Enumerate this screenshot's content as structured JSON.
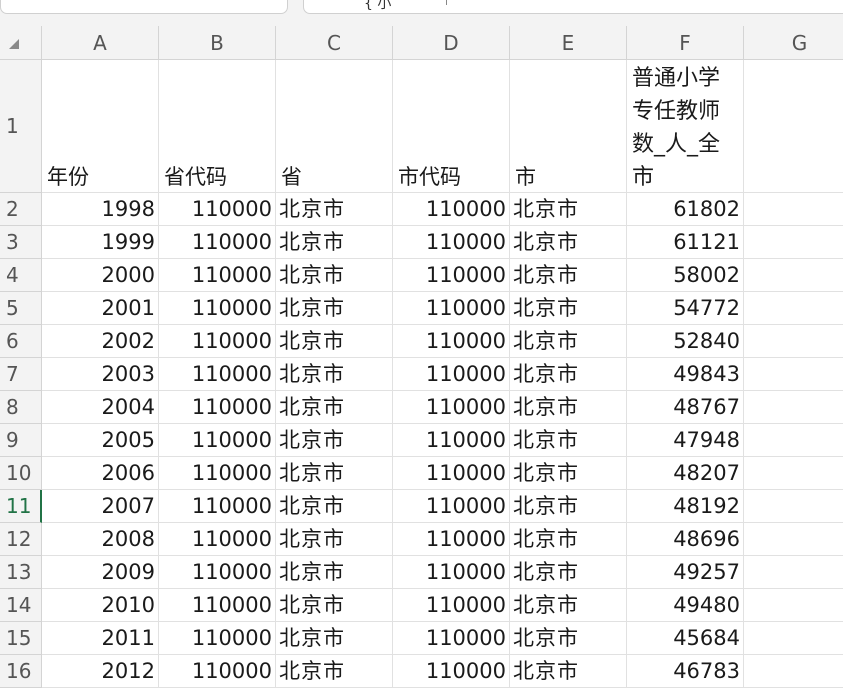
{
  "columns": [
    "A",
    "B",
    "C",
    "D",
    "E",
    "F",
    "G"
  ],
  "rowNumbers": [
    "1",
    "2",
    "3",
    "4",
    "5",
    "6",
    "7",
    "8",
    "9",
    "10",
    "11",
    "12",
    "13",
    "14",
    "15",
    "16"
  ],
  "activeRow": "11",
  "formula_glyph": "{ 小",
  "headers": [
    "年份",
    "省代码",
    "省",
    "市代码",
    "市",
    "普通小学专任教师数_人_全市"
  ],
  "rows": [
    [
      "1998",
      "110000",
      "北京市",
      "110000",
      "北京市",
      "61802"
    ],
    [
      "1999",
      "110000",
      "北京市",
      "110000",
      "北京市",
      "61121"
    ],
    [
      "2000",
      "110000",
      "北京市",
      "110000",
      "北京市",
      "58002"
    ],
    [
      "2001",
      "110000",
      "北京市",
      "110000",
      "北京市",
      "54772"
    ],
    [
      "2002",
      "110000",
      "北京市",
      "110000",
      "北京市",
      "52840"
    ],
    [
      "2003",
      "110000",
      "北京市",
      "110000",
      "北京市",
      "49843"
    ],
    [
      "2004",
      "110000",
      "北京市",
      "110000",
      "北京市",
      "48767"
    ],
    [
      "2005",
      "110000",
      "北京市",
      "110000",
      "北京市",
      "47948"
    ],
    [
      "2006",
      "110000",
      "北京市",
      "110000",
      "北京市",
      "48207"
    ],
    [
      "2007",
      "110000",
      "北京市",
      "110000",
      "北京市",
      "48192"
    ],
    [
      "2008",
      "110000",
      "北京市",
      "110000",
      "北京市",
      "48696"
    ],
    [
      "2009",
      "110000",
      "北京市",
      "110000",
      "北京市",
      "49257"
    ],
    [
      "2010",
      "110000",
      "北京市",
      "110000",
      "北京市",
      "49480"
    ],
    [
      "2011",
      "110000",
      "北京市",
      "110000",
      "北京市",
      "45684"
    ],
    [
      "2012",
      "110000",
      "北京市",
      "110000",
      "北京市",
      "46783"
    ]
  ],
  "colors": {
    "active_row_accent": "#217346",
    "header_bg": "#f3f3f3",
    "gridline": "#e1e1e1"
  }
}
